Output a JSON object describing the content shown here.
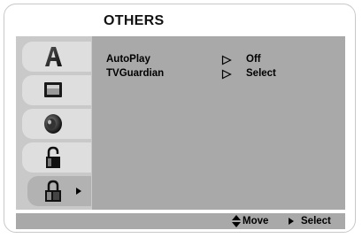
{
  "header": {
    "title": "OTHERS"
  },
  "tabs": [
    {
      "icon": "letter-a-icon",
      "selected": false
    },
    {
      "icon": "tv-screen-icon",
      "selected": false
    },
    {
      "icon": "speaker-icon",
      "selected": false
    },
    {
      "icon": "padlock-icon",
      "selected": false
    },
    {
      "icon": "others-padlock-icon",
      "selected": true
    }
  ],
  "settings": [
    {
      "label": "AutoPlay",
      "value": "Off"
    },
    {
      "label": "TVGuardian",
      "value": "Select"
    }
  ],
  "footer": {
    "move_label": "Move",
    "select_label": "Select"
  },
  "colors": {
    "panel_left": "#c9c9c9",
    "content_bg": "#a9a9a9",
    "tab_bg": "#dedede",
    "tab_selected_bg": "#b2b2b2"
  }
}
